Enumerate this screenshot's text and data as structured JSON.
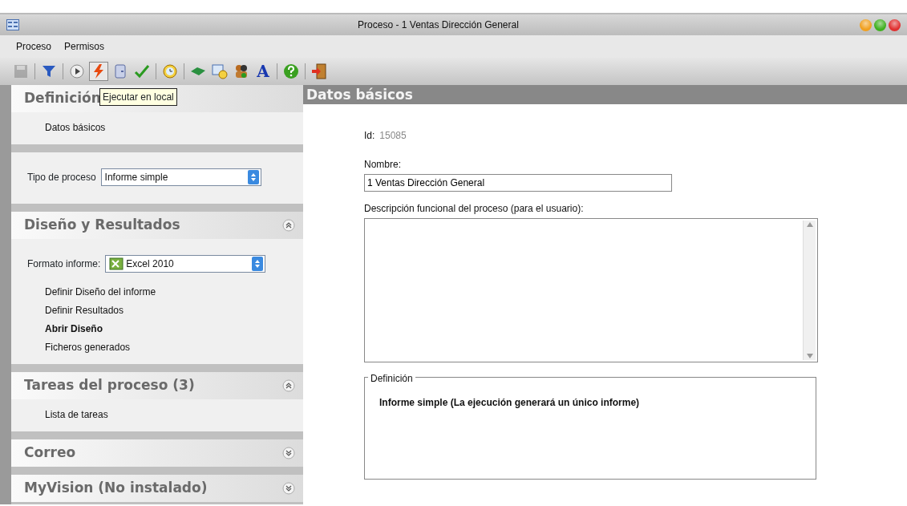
{
  "window": {
    "title": "Proceso - 1 Ventas Dirección General",
    "controls": [
      {
        "color": "#f0a020"
      },
      {
        "color": "#40b020"
      },
      {
        "color": "#e03030"
      }
    ]
  },
  "menu": [
    "Proceso",
    "Permisos"
  ],
  "toolbar": [
    {
      "kind": "save",
      "disabled": true,
      "selected": false
    },
    {
      "kind": "separator"
    },
    {
      "kind": "filter",
      "disabled": false,
      "selected": false
    },
    {
      "kind": "separator"
    },
    {
      "kind": "play",
      "disabled": false,
      "selected": false
    },
    {
      "kind": "lightning",
      "disabled": false,
      "selected": true
    },
    {
      "kind": "panel",
      "disabled": false,
      "selected": false
    },
    {
      "kind": "check",
      "disabled": false,
      "selected": false
    },
    {
      "kind": "separator"
    },
    {
      "kind": "clock",
      "disabled": false,
      "selected": false
    },
    {
      "kind": "separator"
    },
    {
      "kind": "book",
      "disabled": false,
      "selected": false
    },
    {
      "kind": "calendar",
      "disabled": false,
      "selected": false
    },
    {
      "kind": "people",
      "disabled": false,
      "selected": false
    },
    {
      "kind": "letter",
      "label": "A",
      "disabled": false,
      "selected": false
    },
    {
      "kind": "separator"
    },
    {
      "kind": "help",
      "disabled": false,
      "selected": false
    },
    {
      "kind": "separator"
    },
    {
      "kind": "exit",
      "disabled": false,
      "selected": false
    }
  ],
  "tooltip": "Ejecutar en local",
  "sidebar": [
    {
      "title": "Definición",
      "items": [
        {
          "kind": "link",
          "label": "Datos básicos",
          "bold": false
        }
      ]
    },
    {
      "items": [
        {
          "kind": "select",
          "label": "Tipo de proceso",
          "value": "Informe simple"
        }
      ]
    },
    {
      "title": "Diseño y Resultados",
      "expanded": true,
      "items": [
        {
          "kind": "iconselect",
          "label": "Formato informe:",
          "value": "Excel 2010"
        },
        {
          "kind": "link",
          "label": "Definir Diseño del informe",
          "bold": false
        },
        {
          "kind": "link",
          "label": "Definir Resultados",
          "bold": false
        },
        {
          "kind": "link",
          "label": "Abrir Diseño",
          "bold": true
        },
        {
          "kind": "link",
          "label": "Ficheros generados",
          "bold": false
        }
      ]
    },
    {
      "title": "Tareas del proceso (3)",
      "expanded": true,
      "items": [
        {
          "kind": "link",
          "label": "Lista de tareas",
          "bold": false
        }
      ]
    },
    {
      "title": "Correo",
      "expanded": false
    },
    {
      "title": "MyVision (No instalado)",
      "expanded": false
    }
  ],
  "content": {
    "title": "Datos básicos",
    "id_label": "Id:",
    "id_value": "15085",
    "name_label": "Nombre:",
    "name_value": "1 Ventas Dirección General",
    "description_label": "Descripción funcional del proceso (para el usuario):",
    "definition_legend": "Definición",
    "definition_text": "Informe simple (La ejecución generará un único informe)"
  }
}
